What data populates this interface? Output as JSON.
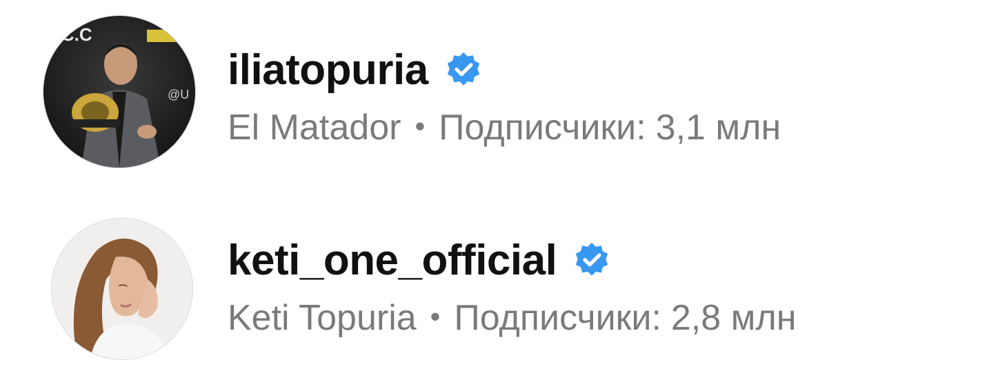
{
  "accounts": [
    {
      "username": "iliatopuria",
      "verified": true,
      "display_name": "El Matador",
      "separator": "•",
      "followers_label": "Подписчики:",
      "followers_value": "3,1 млн",
      "avatar_icon": "profile-photo-fighter-with-belt"
    },
    {
      "username": "keti_one_official",
      "verified": true,
      "display_name": "Keti Topuria",
      "separator": "•",
      "followers_label": "Подписчики:",
      "followers_value": "2,8 млн",
      "avatar_icon": "profile-photo-woman"
    }
  ],
  "colors": {
    "verified_badge": "#3897f0",
    "username_text": "#111111",
    "meta_text": "#7a7a7a"
  }
}
